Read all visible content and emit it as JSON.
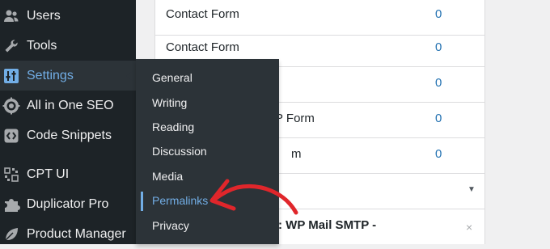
{
  "sidebar": {
    "items": [
      {
        "label": "Users",
        "icon": "users-icon"
      },
      {
        "label": "Tools",
        "icon": "wrench-icon"
      },
      {
        "label": "Settings",
        "icon": "settings-sliders-icon"
      },
      {
        "label": "All in One SEO",
        "icon": "aioseo-gear-icon"
      },
      {
        "label": "Code Snippets",
        "icon": "code-icon"
      },
      {
        "label": "CPT UI",
        "icon": "grid-icon"
      },
      {
        "label": "Duplicator Pro",
        "icon": "puzzle-icon"
      },
      {
        "label": "Product Manager",
        "icon": "leaf-icon"
      }
    ]
  },
  "settings_submenu": {
    "items": [
      "General",
      "Writing",
      "Reading",
      "Discussion",
      "Media",
      "Permalinks",
      "Privacy"
    ],
    "active": "Permalinks"
  },
  "table": {
    "rows": [
      {
        "name": "Contact Form",
        "count": "0"
      },
      {
        "name": "Contact Form",
        "count": "0"
      },
      {
        "name": "",
        "count": "0"
      },
      {
        "name": "P Form",
        "count": "0"
      },
      {
        "name": "m",
        "count": "0"
      },
      {
        "name": "",
        "count": ""
      },
      {
        "name": ": WP Mail SMTP  -",
        "count": ""
      }
    ]
  },
  "colors": {
    "sidebar_bg": "#1d2327",
    "submenu_bg": "#2c3338",
    "accent": "#72aee6",
    "link": "#2271b1",
    "annotation_arrow": "#e0262b"
  }
}
